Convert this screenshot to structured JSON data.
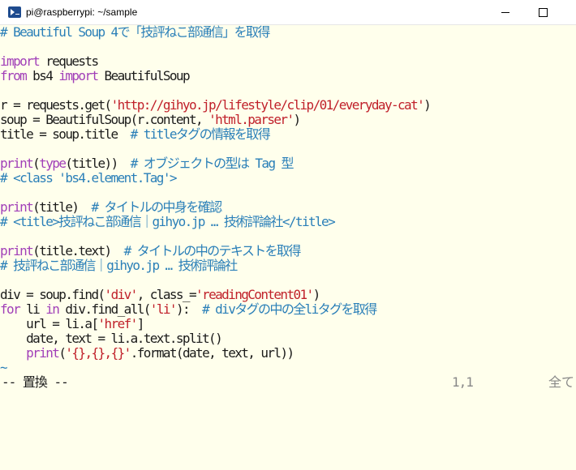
{
  "window": {
    "title": "pi@raspberrypi: ~/sample",
    "icon": "terminal-icon"
  },
  "code": [
    [
      {
        "t": "# Beautiful Soup 4で「技評ねこ部通信」を取得",
        "c": "c"
      }
    ],
    [
      {
        "t": "",
        "c": "n"
      }
    ],
    [
      {
        "t": "import",
        "c": "k"
      },
      {
        "t": " requests",
        "c": "n"
      }
    ],
    [
      {
        "t": "from",
        "c": "k"
      },
      {
        "t": " bs4 ",
        "c": "n"
      },
      {
        "t": "import",
        "c": "k"
      },
      {
        "t": " BeautifulSoup",
        "c": "n"
      }
    ],
    [
      {
        "t": "",
        "c": "n"
      }
    ],
    [
      {
        "t": "r = requests.get(",
        "c": "n"
      },
      {
        "t": "'http://gihyo.jp/lifestyle/clip/01/everyday-cat'",
        "c": "s"
      },
      {
        "t": ")",
        "c": "n"
      }
    ],
    [
      {
        "t": "soup = BeautifulSoup(r.content, ",
        "c": "n"
      },
      {
        "t": "'html.parser'",
        "c": "s"
      },
      {
        "t": ")",
        "c": "n"
      }
    ],
    [
      {
        "t": "title = soup.title  ",
        "c": "n"
      },
      {
        "t": "# titleタグの情報を取得",
        "c": "c"
      }
    ],
    [
      {
        "t": "",
        "c": "n"
      }
    ],
    [
      {
        "t": "print",
        "c": "k"
      },
      {
        "t": "(",
        "c": "n"
      },
      {
        "t": "type",
        "c": "k"
      },
      {
        "t": "(title))  ",
        "c": "n"
      },
      {
        "t": "# オブジェクトの型は Tag 型",
        "c": "c"
      }
    ],
    [
      {
        "t": "# <class 'bs4.element.Tag'>",
        "c": "c"
      }
    ],
    [
      {
        "t": "",
        "c": "n"
      }
    ],
    [
      {
        "t": "print",
        "c": "k"
      },
      {
        "t": "(title)  ",
        "c": "n"
      },
      {
        "t": "# タイトルの中身を確認",
        "c": "c"
      }
    ],
    [
      {
        "t": "# <title>技評ねこ部通信｜gihyo.jp … 技術評論社</title>",
        "c": "c"
      }
    ],
    [
      {
        "t": "",
        "c": "n"
      }
    ],
    [
      {
        "t": "print",
        "c": "k"
      },
      {
        "t": "(title.text)  ",
        "c": "n"
      },
      {
        "t": "# タイトルの中のテキストを取得",
        "c": "c"
      }
    ],
    [
      {
        "t": "# 技評ねこ部通信｜gihyo.jp … 技術評論社",
        "c": "c"
      }
    ],
    [
      {
        "t": "",
        "c": "n"
      }
    ],
    [
      {
        "t": "div = soup.find(",
        "c": "n"
      },
      {
        "t": "'div'",
        "c": "s"
      },
      {
        "t": ", class_=",
        "c": "n"
      },
      {
        "t": "'readingContent01'",
        "c": "s"
      },
      {
        "t": ")",
        "c": "n"
      }
    ],
    [
      {
        "t": "for",
        "c": "k"
      },
      {
        "t": " li ",
        "c": "n"
      },
      {
        "t": "in",
        "c": "k"
      },
      {
        "t": " div.find_all(",
        "c": "n"
      },
      {
        "t": "'li'",
        "c": "s"
      },
      {
        "t": "):  ",
        "c": "n"
      },
      {
        "t": "# divタグの中の全liタグを取得",
        "c": "c"
      }
    ],
    [
      {
        "t": "    url = li.a[",
        "c": "n"
      },
      {
        "t": "'href'",
        "c": "s"
      },
      {
        "t": "]",
        "c": "n"
      }
    ],
    [
      {
        "t": "    date, text = li.a.text.split()",
        "c": "n"
      }
    ],
    [
      {
        "t": "    ",
        "c": "n"
      },
      {
        "t": "print",
        "c": "k"
      },
      {
        "t": "(",
        "c": "n"
      },
      {
        "t": "'{},{},{}'",
        "c": "s"
      },
      {
        "t": ".format(date, text, url))",
        "c": "n"
      }
    ],
    [
      {
        "t": "~",
        "c": "t"
      }
    ]
  ],
  "status": {
    "mode": "-- 置換 --",
    "position": "1,1",
    "scroll": "全て"
  },
  "colors": {
    "background": "#ffffec",
    "comment": "#2a7fb8",
    "keyword": "#a13fb8",
    "string": "#c0202a",
    "text": "#1a1a1a"
  }
}
